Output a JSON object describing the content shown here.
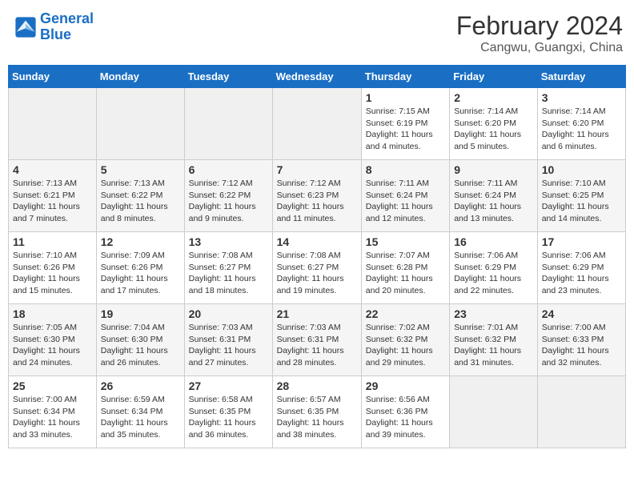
{
  "header": {
    "logo_line1": "General",
    "logo_line2": "Blue",
    "month_year": "February 2024",
    "location": "Cangwu, Guangxi, China"
  },
  "days_of_week": [
    "Sunday",
    "Monday",
    "Tuesday",
    "Wednesday",
    "Thursday",
    "Friday",
    "Saturday"
  ],
  "weeks": [
    [
      {
        "day": "",
        "info": ""
      },
      {
        "day": "",
        "info": ""
      },
      {
        "day": "",
        "info": ""
      },
      {
        "day": "",
        "info": ""
      },
      {
        "day": "1",
        "info": "Sunrise: 7:15 AM\nSunset: 6:19 PM\nDaylight: 11 hours and 4 minutes."
      },
      {
        "day": "2",
        "info": "Sunrise: 7:14 AM\nSunset: 6:20 PM\nDaylight: 11 hours and 5 minutes."
      },
      {
        "day": "3",
        "info": "Sunrise: 7:14 AM\nSunset: 6:20 PM\nDaylight: 11 hours and 6 minutes."
      }
    ],
    [
      {
        "day": "4",
        "info": "Sunrise: 7:13 AM\nSunset: 6:21 PM\nDaylight: 11 hours and 7 minutes."
      },
      {
        "day": "5",
        "info": "Sunrise: 7:13 AM\nSunset: 6:22 PM\nDaylight: 11 hours and 8 minutes."
      },
      {
        "day": "6",
        "info": "Sunrise: 7:12 AM\nSunset: 6:22 PM\nDaylight: 11 hours and 9 minutes."
      },
      {
        "day": "7",
        "info": "Sunrise: 7:12 AM\nSunset: 6:23 PM\nDaylight: 11 hours and 11 minutes."
      },
      {
        "day": "8",
        "info": "Sunrise: 7:11 AM\nSunset: 6:24 PM\nDaylight: 11 hours and 12 minutes."
      },
      {
        "day": "9",
        "info": "Sunrise: 7:11 AM\nSunset: 6:24 PM\nDaylight: 11 hours and 13 minutes."
      },
      {
        "day": "10",
        "info": "Sunrise: 7:10 AM\nSunset: 6:25 PM\nDaylight: 11 hours and 14 minutes."
      }
    ],
    [
      {
        "day": "11",
        "info": "Sunrise: 7:10 AM\nSunset: 6:26 PM\nDaylight: 11 hours and 15 minutes."
      },
      {
        "day": "12",
        "info": "Sunrise: 7:09 AM\nSunset: 6:26 PM\nDaylight: 11 hours and 17 minutes."
      },
      {
        "day": "13",
        "info": "Sunrise: 7:08 AM\nSunset: 6:27 PM\nDaylight: 11 hours and 18 minutes."
      },
      {
        "day": "14",
        "info": "Sunrise: 7:08 AM\nSunset: 6:27 PM\nDaylight: 11 hours and 19 minutes."
      },
      {
        "day": "15",
        "info": "Sunrise: 7:07 AM\nSunset: 6:28 PM\nDaylight: 11 hours and 20 minutes."
      },
      {
        "day": "16",
        "info": "Sunrise: 7:06 AM\nSunset: 6:29 PM\nDaylight: 11 hours and 22 minutes."
      },
      {
        "day": "17",
        "info": "Sunrise: 7:06 AM\nSunset: 6:29 PM\nDaylight: 11 hours and 23 minutes."
      }
    ],
    [
      {
        "day": "18",
        "info": "Sunrise: 7:05 AM\nSunset: 6:30 PM\nDaylight: 11 hours and 24 minutes."
      },
      {
        "day": "19",
        "info": "Sunrise: 7:04 AM\nSunset: 6:30 PM\nDaylight: 11 hours and 26 minutes."
      },
      {
        "day": "20",
        "info": "Sunrise: 7:03 AM\nSunset: 6:31 PM\nDaylight: 11 hours and 27 minutes."
      },
      {
        "day": "21",
        "info": "Sunrise: 7:03 AM\nSunset: 6:31 PM\nDaylight: 11 hours and 28 minutes."
      },
      {
        "day": "22",
        "info": "Sunrise: 7:02 AM\nSunset: 6:32 PM\nDaylight: 11 hours and 29 minutes."
      },
      {
        "day": "23",
        "info": "Sunrise: 7:01 AM\nSunset: 6:32 PM\nDaylight: 11 hours and 31 minutes."
      },
      {
        "day": "24",
        "info": "Sunrise: 7:00 AM\nSunset: 6:33 PM\nDaylight: 11 hours and 32 minutes."
      }
    ],
    [
      {
        "day": "25",
        "info": "Sunrise: 7:00 AM\nSunset: 6:34 PM\nDaylight: 11 hours and 33 minutes."
      },
      {
        "day": "26",
        "info": "Sunrise: 6:59 AM\nSunset: 6:34 PM\nDaylight: 11 hours and 35 minutes."
      },
      {
        "day": "27",
        "info": "Sunrise: 6:58 AM\nSunset: 6:35 PM\nDaylight: 11 hours and 36 minutes."
      },
      {
        "day": "28",
        "info": "Sunrise: 6:57 AM\nSunset: 6:35 PM\nDaylight: 11 hours and 38 minutes."
      },
      {
        "day": "29",
        "info": "Sunrise: 6:56 AM\nSunset: 6:36 PM\nDaylight: 11 hours and 39 minutes."
      },
      {
        "day": "",
        "info": ""
      },
      {
        "day": "",
        "info": ""
      }
    ]
  ]
}
